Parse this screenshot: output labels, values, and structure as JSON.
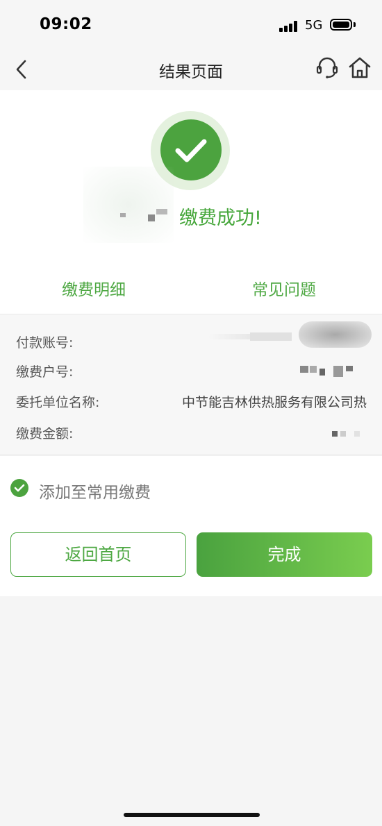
{
  "status_bar": {
    "time": "09:02",
    "network": "5G"
  },
  "nav": {
    "title": "结果页面",
    "icons": [
      "back-icon",
      "customer-service-icon",
      "home-icon"
    ]
  },
  "result": {
    "message": "缴费成功!",
    "icon": "check-circle-icon",
    "accent_color": "#4ca33f"
  },
  "links": {
    "detail": "缴费明细",
    "faq": "常见问题"
  },
  "details": [
    {
      "label": "付款账号:",
      "value": ""
    },
    {
      "label": "缴费户号:",
      "value": ""
    },
    {
      "label": "委托单位名称:",
      "value": "中节能吉林供热服务有限公司热"
    },
    {
      "label": "缴费金额:",
      "value": ""
    }
  ],
  "option": {
    "label": "添加至常用缴费",
    "checked": true
  },
  "buttons": {
    "home": "返回首页",
    "done": "完成"
  }
}
